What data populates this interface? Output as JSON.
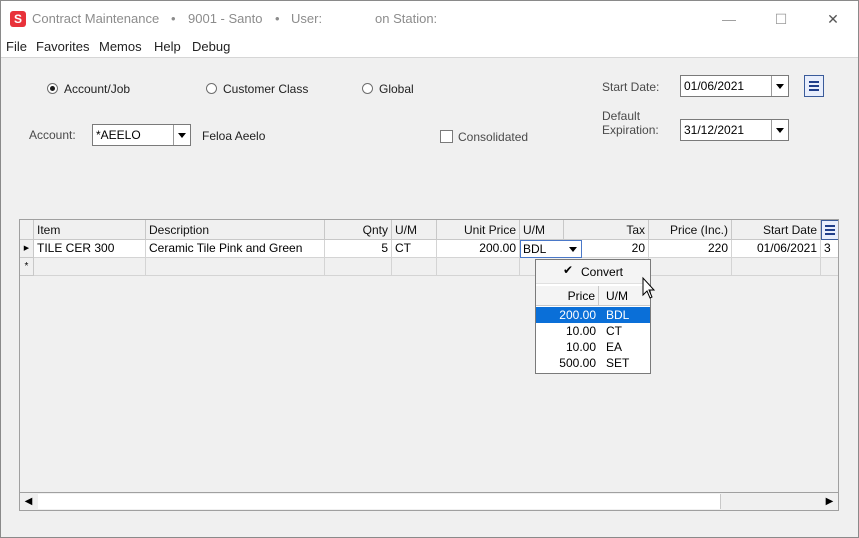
{
  "window": {
    "title": "Contract Maintenance",
    "title_sep": "•",
    "company": "9001 - Santo",
    "user_label": "User:",
    "station_label": "on Station:",
    "minimize": "—",
    "maximize": "☐",
    "close": "✕"
  },
  "menu": [
    "File",
    "Favorites",
    "Memos",
    "Help",
    "Debug"
  ],
  "scope": {
    "options": [
      {
        "label": "Account/Job",
        "checked": true
      },
      {
        "label": "Customer Class",
        "checked": false
      },
      {
        "label": "Global",
        "checked": false
      }
    ]
  },
  "account": {
    "label": "Account:",
    "value": "*AEELO",
    "name": "Feloa Aeelo"
  },
  "consolidated": {
    "label": "Consolidated",
    "checked": false
  },
  "dates": {
    "start_label": "Start Date:",
    "start_value": "01/06/2021",
    "expiry_label_1": "Default",
    "expiry_label_2": "Expiration:",
    "expiry_value": "31/12/2021"
  },
  "grid": {
    "columns": [
      "Item",
      "Description",
      "Qnty",
      "U/M",
      "Unit Price",
      "U/M",
      "Tax",
      "Price (Inc.)",
      "Start Date"
    ],
    "rows": [
      {
        "marker": "▶",
        "item": "TILE CER 300",
        "description": "Ceramic Tile Pink and Green",
        "qnty": "5",
        "um": "CT",
        "unit_price": "200.00",
        "price_um": "BDL",
        "tax": "20",
        "price_inc": "220",
        "start_date": "01/06/2021",
        "overflow": "3"
      }
    ],
    "new_row_marker": "*"
  },
  "um_dropdown": {
    "convert_label": "Convert",
    "convert_checked": true,
    "headers": [
      "Price",
      "U/M"
    ],
    "options": [
      {
        "price": "200.00",
        "um": "BDL",
        "selected": true
      },
      {
        "price": "10.00",
        "um": "CT",
        "selected": false
      },
      {
        "price": "10.00",
        "um": "EA",
        "selected": false
      },
      {
        "price": "500.00",
        "um": "SET",
        "selected": false
      }
    ]
  },
  "scrollbar": {
    "left_arrow": "◀",
    "right_arrow": "▶"
  },
  "colors": {
    "selection": "#0a6fd8",
    "app_icon": "#e8323a",
    "menu_button": "#1f3e8a"
  }
}
